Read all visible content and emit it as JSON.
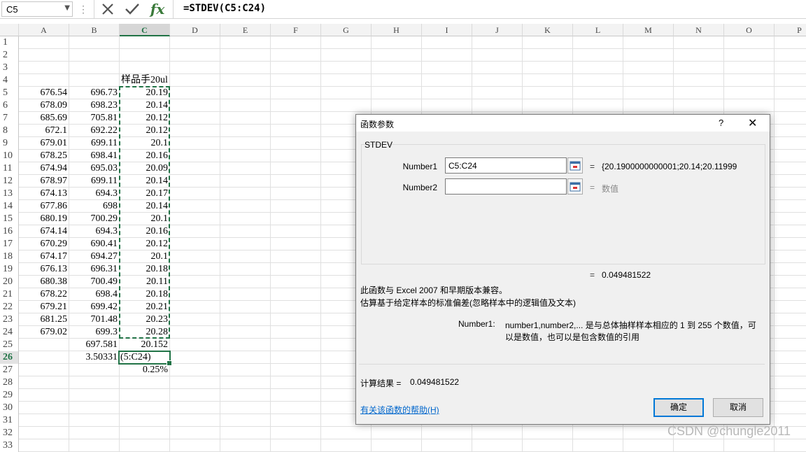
{
  "formula_bar": {
    "name_box": "C5",
    "formula": "=STDEV(C5:C24)"
  },
  "columns": [
    "A",
    "B",
    "C",
    "D",
    "E",
    "F",
    "G",
    "H",
    "I",
    "J",
    "K",
    "L",
    "M",
    "N",
    "O",
    "P"
  ],
  "selected_column": "C",
  "rows": [
    "1",
    "2",
    "3",
    "4",
    "5",
    "6",
    "7",
    "8",
    "9",
    "10",
    "11",
    "12",
    "13",
    "14",
    "15",
    "16",
    "17",
    "18",
    "19",
    "20",
    "21",
    "22",
    "23",
    "24",
    "25",
    "26",
    "27",
    "28",
    "29",
    "30",
    "31",
    "32",
    "33"
  ],
  "selected_row": "26",
  "header_cell_C4": "样品手20ul",
  "data_rows": [
    {
      "row": "5",
      "a": "676.54",
      "b": "696.73",
      "c": "20.19"
    },
    {
      "row": "6",
      "a": "678.09",
      "b": "698.23",
      "c": "20.14"
    },
    {
      "row": "7",
      "a": "685.69",
      "b": "705.81",
      "c": "20.12"
    },
    {
      "row": "8",
      "a": "672.1",
      "b": "692.22",
      "c": "20.12"
    },
    {
      "row": "9",
      "a": "679.01",
      "b": "699.11",
      "c": "20.1"
    },
    {
      "row": "10",
      "a": "678.25",
      "b": "698.41",
      "c": "20.16"
    },
    {
      "row": "11",
      "a": "674.94",
      "b": "695.03",
      "c": "20.09"
    },
    {
      "row": "12",
      "a": "678.97",
      "b": "699.11",
      "c": "20.14"
    },
    {
      "row": "13",
      "a": "674.13",
      "b": "694.3",
      "c": "20.17"
    },
    {
      "row": "14",
      "a": "677.86",
      "b": "698",
      "c": "20.14"
    },
    {
      "row": "15",
      "a": "680.19",
      "b": "700.29",
      "c": "20.1"
    },
    {
      "row": "16",
      "a": "674.14",
      "b": "694.3",
      "c": "20.16"
    },
    {
      "row": "17",
      "a": "670.29",
      "b": "690.41",
      "c": "20.12"
    },
    {
      "row": "18",
      "a": "674.17",
      "b": "694.27",
      "c": "20.1"
    },
    {
      "row": "19",
      "a": "676.13",
      "b": "696.31",
      "c": "20.18"
    },
    {
      "row": "20",
      "a": "680.38",
      "b": "700.49",
      "c": "20.11"
    },
    {
      "row": "21",
      "a": "678.22",
      "b": "698.4",
      "c": "20.18"
    },
    {
      "row": "22",
      "a": "679.21",
      "b": "699.42",
      "c": "20.21"
    },
    {
      "row": "23",
      "a": "681.25",
      "b": "701.48",
      "c": "20.23"
    },
    {
      "row": "24",
      "a": "679.02",
      "b": "699.3",
      "c": "20.28"
    }
  ],
  "summary": {
    "b25": "697.581",
    "c25": "20.152",
    "b26": "3.50331",
    "c26_edit": "(5:C24)",
    "c27": "0.25%"
  },
  "dialog": {
    "title": "函数参数",
    "help_glyph": "?",
    "close_glyph": "✕",
    "function_name": "STDEV",
    "arg1_label": "Number1",
    "arg1_value": "C5:C24",
    "arg1_result": "{20.1900000000001;20.14;20.11999",
    "arg2_label": "Number2",
    "arg2_value": "",
    "arg2_placeholder": "数值",
    "equals": "=",
    "formula_result": "0.049481522",
    "compat_note": "此函数与 Excel 2007 和早期版本兼容。",
    "description": "估算基于给定样本的标准偏差(忽略样本中的逻辑值及文本)",
    "arg_help_label": "Number1:",
    "arg_help_text_1": "number1,number2,... 是与总体抽样样本相应的 1 到 255 个数值，可",
    "arg_help_text_2": "以是数值，也可以是包含数值的引用",
    "calc_result_label": "计算结果 =",
    "calc_result_value": "0.049481522",
    "help_link": "有关该函数的帮助(H)",
    "ok_label": "确定",
    "cancel_label": "取消"
  },
  "watermark": "CSDN @chungle2011",
  "colors": {
    "accent": "#217346",
    "link": "#0066cc",
    "focus": "#0078d7"
  },
  "icons": {
    "cancel": "cancel-x-icon",
    "enter": "check-icon",
    "function": "fx-icon",
    "ref": "range-select-icon"
  }
}
